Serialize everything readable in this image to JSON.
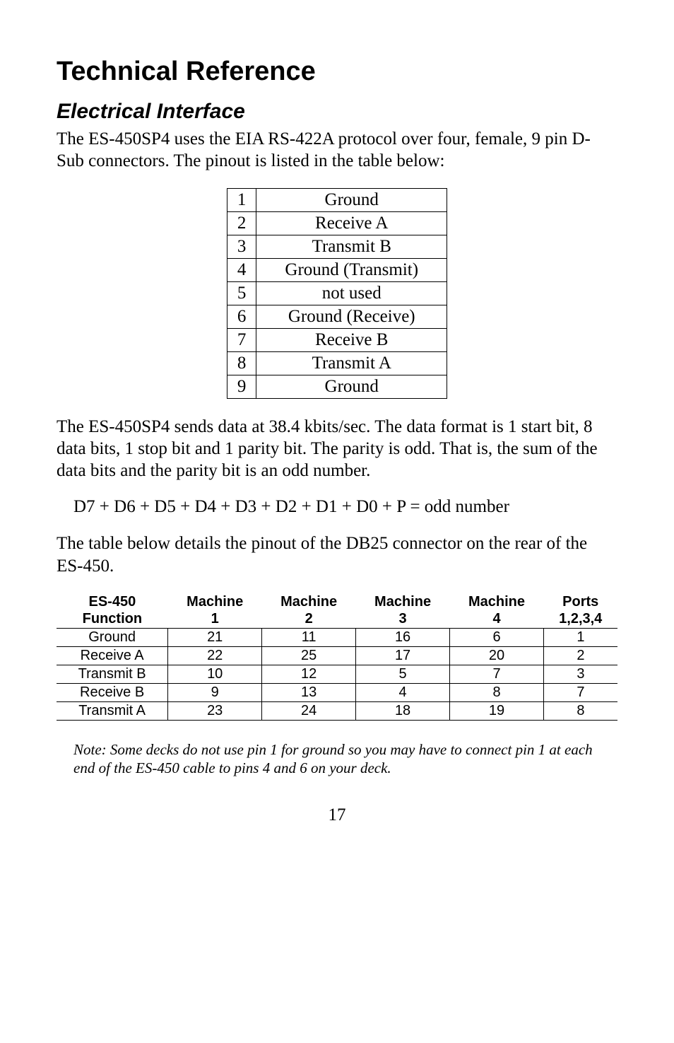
{
  "title": "Technical Reference",
  "section": "Electrical Interface",
  "intro": "The ES-450SP4 uses the EIA RS-422A protocol over four, female, 9 pin D-Sub connectors.  The pinout is listed in the table below:",
  "pinout": [
    {
      "pin": "1",
      "signal": "Ground"
    },
    {
      "pin": "2",
      "signal": "Receive A"
    },
    {
      "pin": "3",
      "signal": "Transmit B"
    },
    {
      "pin": "4",
      "signal": "Ground (Transmit)"
    },
    {
      "pin": "5",
      "signal": "not used"
    },
    {
      "pin": "6",
      "signal": "Ground (Receive)"
    },
    {
      "pin": "7",
      "signal": "Receive B"
    },
    {
      "pin": "8",
      "signal": "Transmit A"
    },
    {
      "pin": "9",
      "signal": "Ground"
    }
  ],
  "para2": "The ES-450SP4 sends data at 38.4 kbits/sec.  The data format is 1 start bit, 8 data bits, 1 stop bit and 1 parity bit.  The parity is odd.  That is, the sum of the data bits and the parity bit is an odd number.",
  "equation": "D7 + D6 + D5 + D4 + D3 + D2 + D1 + D0 + P = odd number",
  "para3": "The table below details the pinout of the DB25 connector on the rear of the ES-450.",
  "db25_headers": {
    "c0a": "ES-450",
    "c0b": "Function",
    "c1a": "Machine",
    "c1b": "1",
    "c2a": "Machine",
    "c2b": "2",
    "c3a": "Machine",
    "c3b": "3",
    "c4a": "Machine",
    "c4b": "4",
    "c5a": "Ports",
    "c5b": "1,2,3,4"
  },
  "db25_rows": [
    {
      "func": "Ground",
      "m1": "21",
      "m2": "11",
      "m3": "16",
      "m4": "6",
      "ports": "1"
    },
    {
      "func": "Receive A",
      "m1": "22",
      "m2": "25",
      "m3": "17",
      "m4": "20",
      "ports": "2"
    },
    {
      "func": "Transmit B",
      "m1": "10",
      "m2": "12",
      "m3": "5",
      "m4": "7",
      "ports": "3"
    },
    {
      "func": "Receive B",
      "m1": "9",
      "m2": "13",
      "m3": "4",
      "m4": "8",
      "ports": "7"
    },
    {
      "func": "Transmit A",
      "m1": "23",
      "m2": "24",
      "m3": "18",
      "m4": "19",
      "ports": "8"
    }
  ],
  "note": "Note: Some decks do not use pin 1 for ground so you may have to connect pin 1 at each end of the ES-450 cable to pins 4 and 6 on your deck.",
  "page": "17"
}
